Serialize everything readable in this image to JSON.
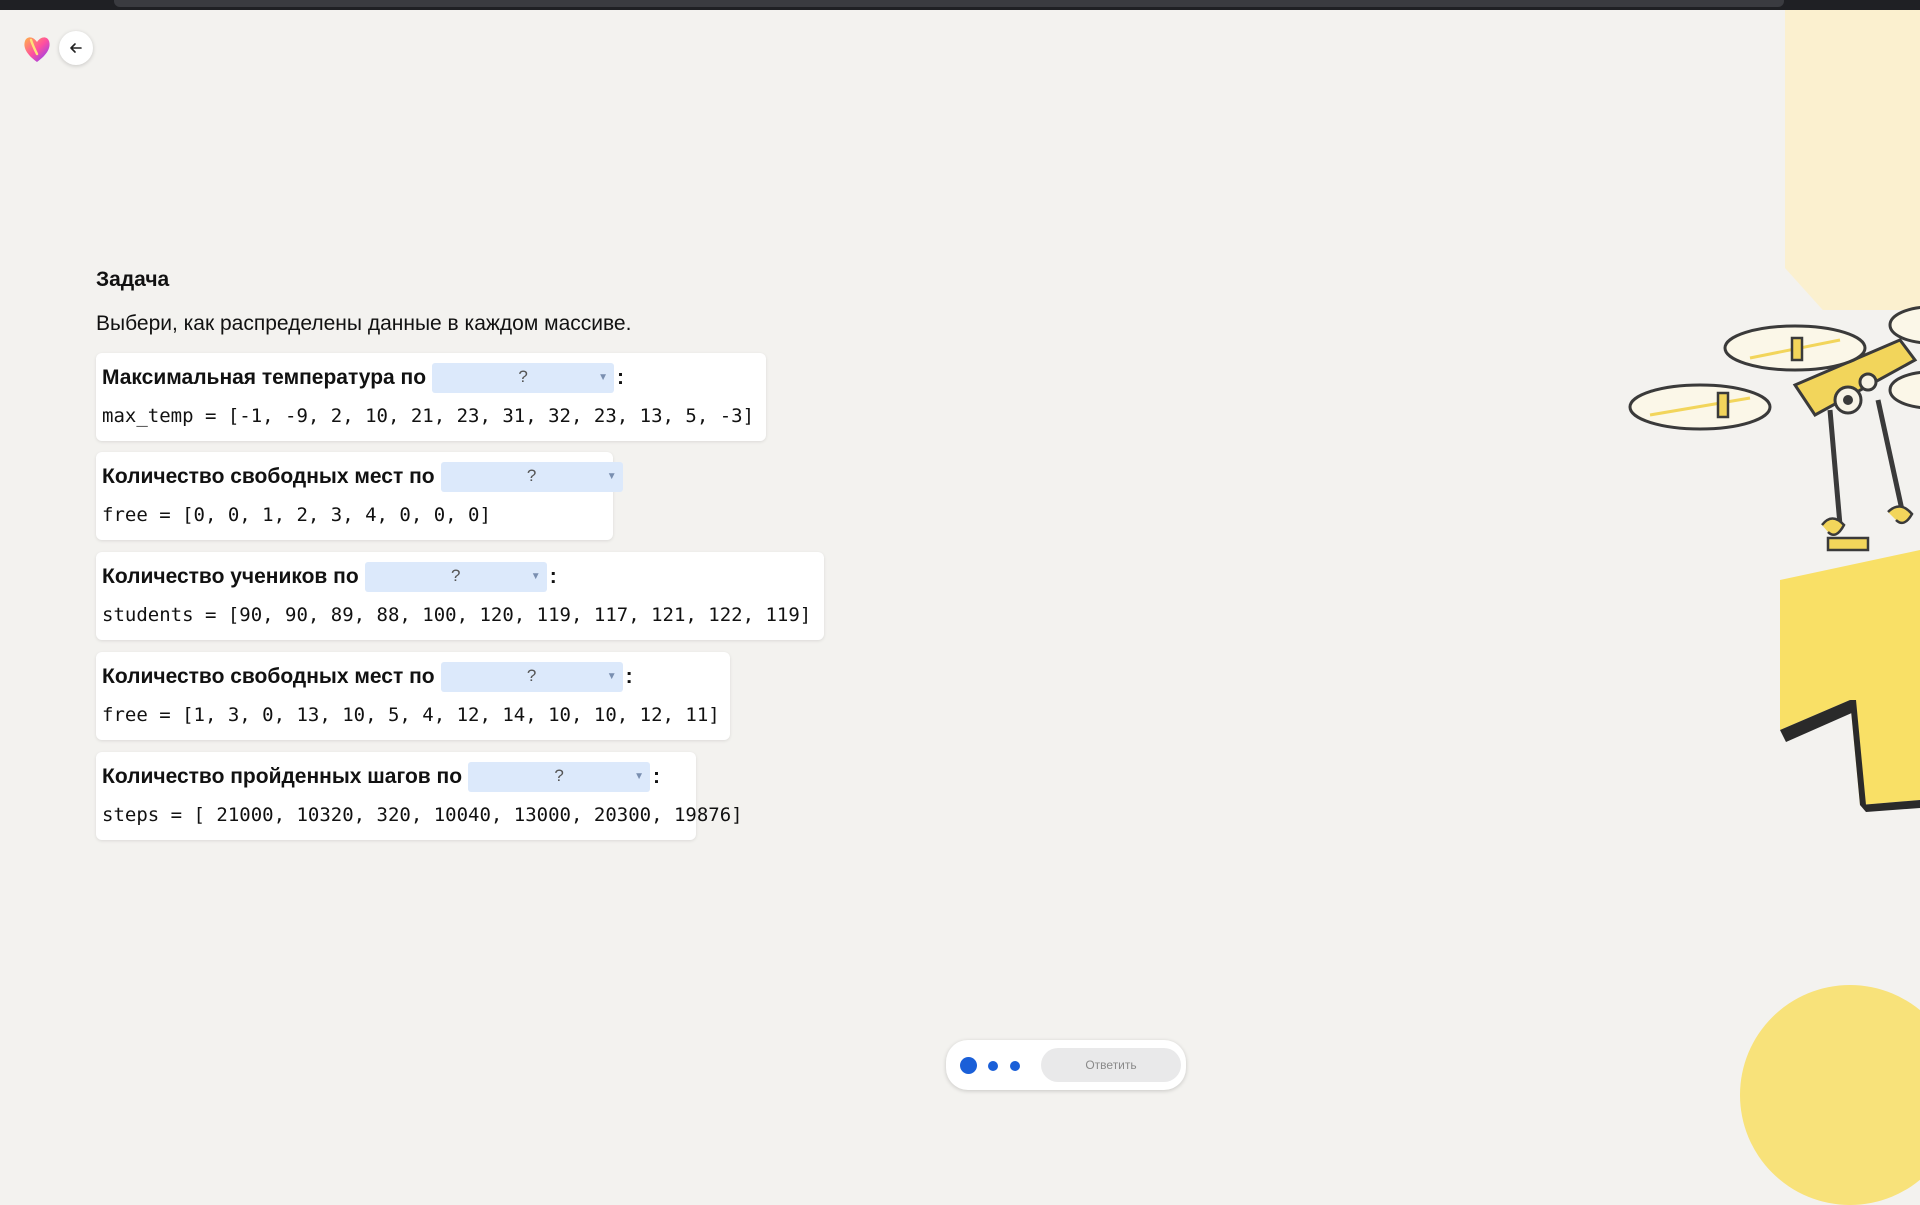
{
  "task": {
    "title": "Задача",
    "instruction": "Выбери, как распределены данные в каждом массиве."
  },
  "cards": [
    {
      "label": "Максимальная температура по",
      "dropdown": "?",
      "colon": ":",
      "code": "max_temp = [-1, -9, 2, 10, 21, 23, 31, 32, 23, 13, 5, -3]"
    },
    {
      "label": "Количество свободных мест по",
      "dropdown": "?",
      "colon": "",
      "code": "free = [0, 0, 1, 2, 3, 4, 0, 0, 0]"
    },
    {
      "label": "Количество учеников по",
      "dropdown": "?",
      "colon": ":",
      "code": "students = [90, 90, 89, 88, 100, 120, 119, 117, 121, 122, 119]"
    },
    {
      "label": "Количество свободных мест по",
      "dropdown": "?",
      "colon": ":",
      "code": "free = [1, 3, 0, 13, 10, 5, 4, 12, 14, 10, 10, 12, 11]"
    },
    {
      "label": "Количество пройденных шагов по",
      "dropdown": "?",
      "colon": ":",
      "code": "steps = [ 21000, 10320, 320, 10040, 13000, 20300, 19876]"
    }
  ],
  "bottom": {
    "answer_label": "Ответить"
  },
  "icons": {
    "logo": "heart-logo-icon",
    "back": "arrow-left-icon",
    "dropdown": "chevron-down-icon"
  },
  "colors": {
    "accent": "#1a5fd8",
    "dropdown_bg": "#dce9fb",
    "decor_yellow": "#f8e27a"
  }
}
